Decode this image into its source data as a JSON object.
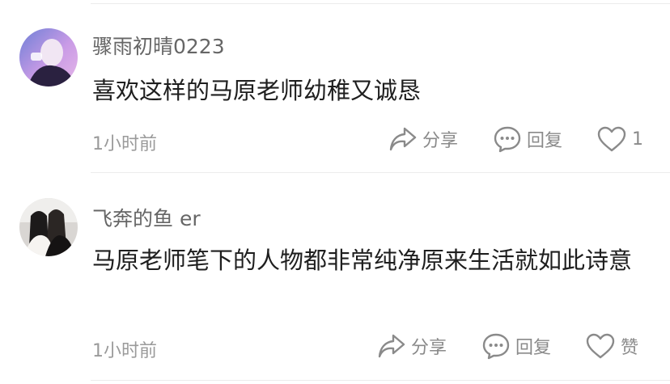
{
  "comments": [
    {
      "username": "骤雨初晴0223",
      "text": "喜欢这样的马原老师幼稚又诚恳",
      "time": "1小时前",
      "share_label": "分享",
      "reply_label": "回复",
      "like_label": "1"
    },
    {
      "username": "飞奔的鱼 er",
      "text": "马原老师笔下的人物都非常纯净原来生活就如此诗意",
      "time": "1小时前",
      "share_label": "分享",
      "reply_label": "回复",
      "like_label": "赞"
    }
  ],
  "icons": {
    "share": "share-icon",
    "reply": "comment-bubble-icon",
    "like": "heart-outline-icon"
  },
  "colors": {
    "username": "#666666",
    "text": "#1e1e1e",
    "meta": "#9a9a9a",
    "icon": "#8a8a8a",
    "divider": "#ececec"
  }
}
